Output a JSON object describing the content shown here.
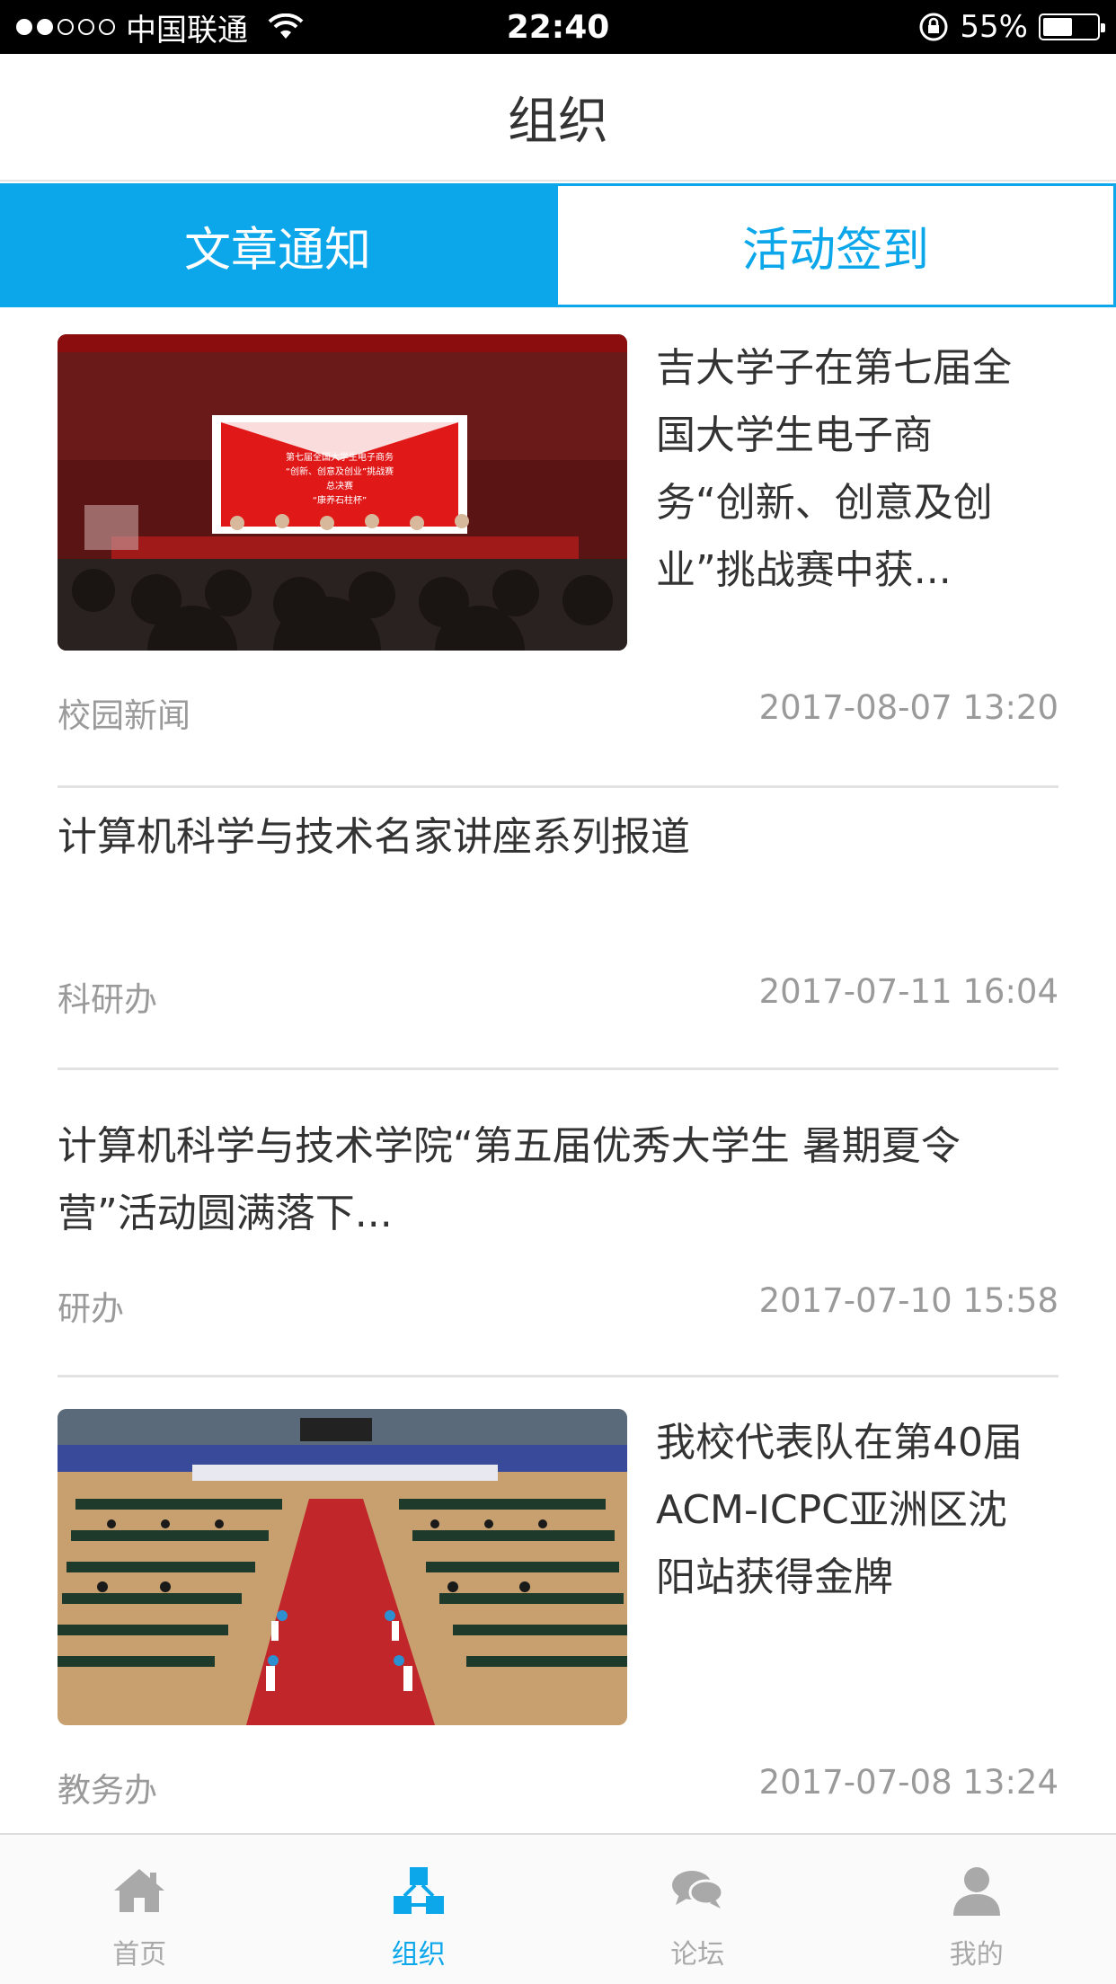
{
  "status_bar": {
    "carrier": "中国联通",
    "time": "22:40",
    "battery_percent_text": "55%",
    "battery_level": 0.55
  },
  "header": {
    "title": "组织"
  },
  "tabs": [
    {
      "label": "文章通知",
      "active": true
    },
    {
      "label": "活动签到",
      "active": false
    }
  ],
  "articles": [
    {
      "title": "吉大学子在第七届全国大学生电子商务“创新、创意及创业”挑战赛中获...",
      "title_lines": [
        "吉大学子在第七届全",
        "国大学生电子商",
        "务“创新、创意及创",
        "业”挑战赛中获..."
      ],
      "source": "校园新闻",
      "date": "2017-08-07 13:20",
      "has_image": true,
      "image_banner_text": [
        "第七届全国大学生电子商务",
        "“创新、创意及创业”挑战赛",
        "总决赛",
        "“康养石柱杯”"
      ]
    },
    {
      "title": "计算机科学与技术名家讲座系列报道",
      "title_lines": [
        "计算机科学与技术名家讲座系列报道"
      ],
      "source": "科研办",
      "date": "2017-07-11 16:04",
      "has_image": false
    },
    {
      "title": "计算机科学与技术学院“第五届优秀大学生 暑期夏令营”活动圆满落下...",
      "title_lines": [
        "计算机科学与技术学院“第五届优秀大学生 暑期夏令",
        "营”活动圆满落下..."
      ],
      "source": "研办",
      "date": "2017-07-10 15:58",
      "has_image": false
    },
    {
      "title": "我校代表队在第40届ACM-ICPC亚洲区沈阳站获得金牌",
      "title_lines": [
        "我校代表队在第40届",
        "ACM-ICPC亚洲区沈",
        "阳站获得金牌"
      ],
      "source": "教务办",
      "date": "2017-07-08 13:24",
      "has_image": true
    }
  ],
  "tabbar": [
    {
      "label": "首页",
      "icon": "home-icon",
      "active": false
    },
    {
      "label": "组织",
      "icon": "organization-icon",
      "active": true
    },
    {
      "label": "论坛",
      "icon": "chat-bubbles-icon",
      "active": false
    },
    {
      "label": "我的",
      "icon": "user-icon",
      "active": false
    }
  ],
  "colors": {
    "accent": "#0ba7ea",
    "text_primary": "#333333",
    "text_secondary": "#9a9a9a",
    "tab_inactive": "#a9a9a9"
  }
}
